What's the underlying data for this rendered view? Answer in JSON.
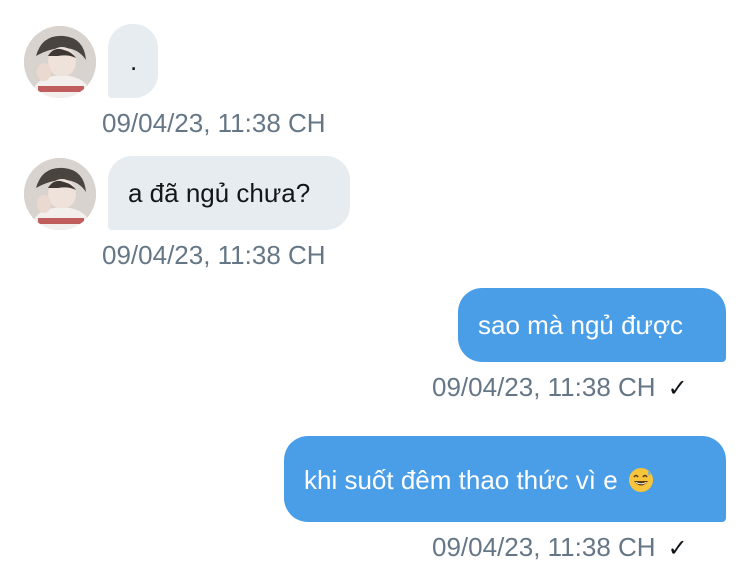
{
  "messages": [
    {
      "direction": "incoming",
      "text": ".",
      "timestamp": "09/04/23, 11:38 CH"
    },
    {
      "direction": "incoming",
      "text": "a đã ngủ chưa?",
      "timestamp": "09/04/23, 11:38 CH"
    },
    {
      "direction": "outgoing",
      "text": "sao mà ngủ được",
      "timestamp": "09/04/23, 11:38 CH",
      "status_icon": "checkmark-icon",
      "status_glyph": "✓"
    },
    {
      "direction": "outgoing",
      "text": "khi suốt đêm thao thức vì e",
      "emoji_icon": "grinning-sweat-emoji",
      "timestamp": "09/04/23, 11:38 CH",
      "status_icon": "checkmark-icon",
      "status_glyph": "✓"
    }
  ],
  "colors": {
    "incoming_bubble": "#e6ecf0",
    "outgoing_bubble": "#4a9ee8",
    "timestamp_text": "#657786",
    "incoming_text": "#14171a",
    "outgoing_text": "#ffffff"
  }
}
